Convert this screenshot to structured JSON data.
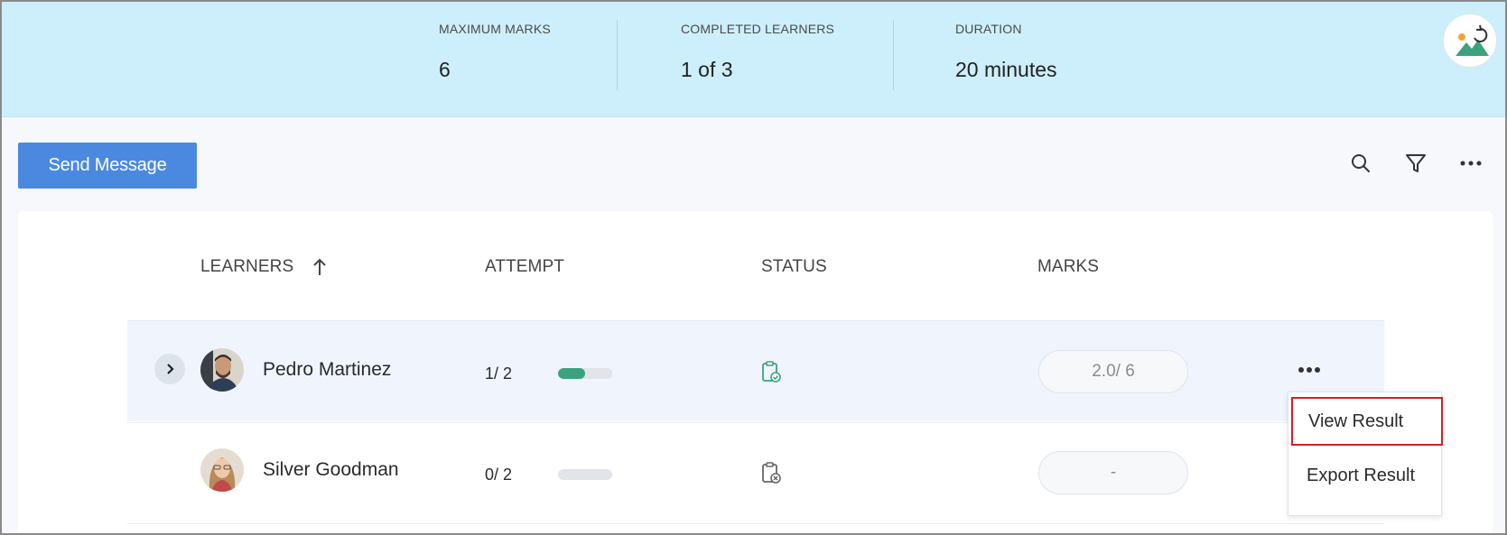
{
  "header": {
    "stats": [
      {
        "label": "MAXIMUM MARKS",
        "value": "6"
      },
      {
        "label": "COMPLETED LEARNERS",
        "value": "1 of 3"
      },
      {
        "label": "DURATION",
        "value": "20 minutes"
      }
    ],
    "app_icon": "landscape-refresh-icon"
  },
  "toolbar": {
    "send_message_label": "Send Message",
    "icons": [
      "search-icon",
      "filter-icon",
      "more-horizontal-icon"
    ]
  },
  "table": {
    "columns": [
      "LEARNERS",
      "ATTEMPT",
      "STATUS",
      "MARKS"
    ],
    "sort_column": "LEARNERS",
    "sort_direction": "ascending",
    "rows": [
      {
        "name": "Pedro Martinez",
        "attempt": "1/ 2",
        "attempt_progress": 0.5,
        "status_icon": "clipboard-check-icon",
        "marks": "2.0/ 6",
        "expanded_toggle": true,
        "highlighted": true
      },
      {
        "name": "Silver Goodman",
        "attempt": "0/ 2",
        "attempt_progress": 0,
        "status_icon": "clipboard-cross-icon",
        "marks": "-",
        "expanded_toggle": false,
        "highlighted": false
      }
    ]
  },
  "row_menu": {
    "items": [
      "View Result",
      "Export Result"
    ],
    "selected": "View Result"
  },
  "colors": {
    "header_bg": "#cdeffb",
    "primary_button": "#4b89e0",
    "progress_fill": "#3aa37d",
    "status_icon": "#3aa37d",
    "selection_border": "#d32026",
    "row_highlight": "#f0f5fd"
  }
}
